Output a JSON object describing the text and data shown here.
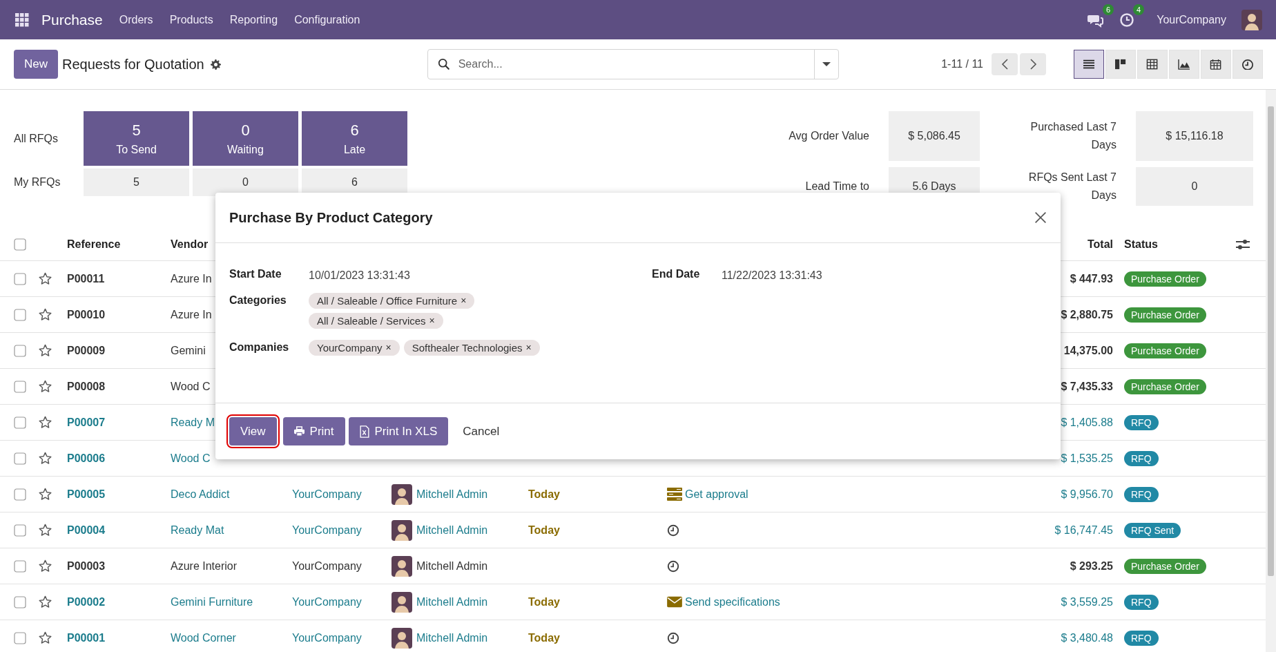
{
  "navbar": {
    "app": "Purchase",
    "menu": [
      "Orders",
      "Products",
      "Reporting",
      "Configuration"
    ],
    "messages_count": "6",
    "activities_count": "4",
    "company": "YourCompany"
  },
  "control_panel": {
    "new_button": "New",
    "title": "Requests for Quotation",
    "search": {
      "placeholder": "Search..."
    },
    "pager": "1-11 / 11",
    "views": [
      {
        "kind": "list",
        "selected": true
      },
      {
        "kind": "kanban",
        "selected": false
      },
      {
        "kind": "pivot",
        "selected": false
      },
      {
        "kind": "graph",
        "selected": false
      },
      {
        "kind": "calendar",
        "selected": false
      },
      {
        "kind": "activity",
        "selected": false
      }
    ]
  },
  "dashboard": {
    "rows": [
      {
        "label": "All RFQs",
        "kind": "tile",
        "cells": [
          {
            "value": "5",
            "caption": "To Send"
          },
          {
            "value": "0",
            "caption": "Waiting"
          },
          {
            "value": "6",
            "caption": "Late"
          }
        ]
      },
      {
        "label": "My RFQs",
        "kind": "plain",
        "cells": [
          {
            "value": "5"
          },
          {
            "value": "0"
          },
          {
            "value": "6"
          }
        ]
      }
    ],
    "stats": [
      {
        "label": "Avg Order Value",
        "value": "$ 5,086.45"
      },
      {
        "label": "Purchased Last 7 Days",
        "value": "$ 15,116.18"
      },
      {
        "label": "Lead Time to",
        "value": "5.6 Days"
      },
      {
        "label": "RFQs Sent Last 7 Days",
        "value": "0"
      }
    ]
  },
  "table": {
    "header_checkbox": {
      "checked": false
    },
    "columns": {
      "reference": "Reference",
      "vendor": "Vendor",
      "total": "Total",
      "status": "Status"
    },
    "rows": [
      {
        "checked": false,
        "starred": false,
        "highlight": false,
        "reference": "P00011",
        "vendor": "Azure In",
        "total": "$ 447.93",
        "status": {
          "label": "Purchase Order",
          "kind": "purchase"
        }
      },
      {
        "checked": false,
        "starred": false,
        "highlight": false,
        "reference": "P00010",
        "vendor": "Azure In",
        "total": "$ 2,880.75",
        "status": {
          "label": "Purchase Order",
          "kind": "purchase"
        }
      },
      {
        "checked": false,
        "starred": false,
        "highlight": false,
        "reference": "P00009",
        "vendor": "Gemini",
        "total": "14,375.00",
        "status": {
          "label": "Purchase Order",
          "kind": "purchase"
        }
      },
      {
        "checked": false,
        "starred": false,
        "highlight": false,
        "reference": "P00008",
        "vendor": "Wood C",
        "total": "$ 7,435.33",
        "status": {
          "label": "Purchase Order",
          "kind": "purchase"
        }
      },
      {
        "checked": false,
        "starred": false,
        "highlight": true,
        "reference": "P00007",
        "vendor": "Ready M",
        "total": "$ 1,405.88",
        "status": {
          "label": "RFQ",
          "kind": "rfq"
        }
      },
      {
        "checked": false,
        "starred": false,
        "highlight": true,
        "reference": "P00006",
        "vendor": "Wood C",
        "total": "$ 1,535.25",
        "status": {
          "label": "RFQ",
          "kind": "rfq"
        }
      },
      {
        "checked": false,
        "starred": false,
        "highlight": true,
        "reference": "P00005",
        "vendor": "Deco Addict",
        "company": "YourCompany",
        "buyer": "Mitchell Admin",
        "deadline": "Today",
        "activity": {
          "kind": "approval",
          "text": "Get approval"
        },
        "total": "$ 9,956.70",
        "status": {
          "label": "RFQ",
          "kind": "rfq"
        }
      },
      {
        "checked": false,
        "starred": false,
        "highlight": true,
        "reference": "P00004",
        "vendor": "Ready Mat",
        "company": "YourCompany",
        "buyer": "Mitchell Admin",
        "deadline": "Today",
        "activity": {
          "kind": "clock"
        },
        "total": "$ 16,747.45",
        "status": {
          "label": "RFQ Sent",
          "kind": "rfq"
        }
      },
      {
        "checked": false,
        "starred": false,
        "highlight": false,
        "reference": "P00003",
        "vendor": "Azure Interior",
        "company": "YourCompany",
        "buyer": "Mitchell Admin",
        "activity": {
          "kind": "clock"
        },
        "total": "$ 293.25",
        "status": {
          "label": "Purchase Order",
          "kind": "purchase"
        }
      },
      {
        "checked": false,
        "starred": false,
        "highlight": true,
        "reference": "P00002",
        "vendor": "Gemini Furniture",
        "company": "YourCompany",
        "buyer": "Mitchell Admin",
        "deadline": "Today",
        "activity": {
          "kind": "email",
          "text": "Send specifications"
        },
        "total": "$ 3,559.25",
        "status": {
          "label": "RFQ",
          "kind": "rfq"
        }
      },
      {
        "checked": false,
        "starred": false,
        "highlight": true,
        "reference": "P00001",
        "vendor": "Wood Corner",
        "company": "YourCompany",
        "buyer": "Mitchell Admin",
        "deadline": "Today",
        "activity": {
          "kind": "clock"
        },
        "total": "$ 3,480.48",
        "status": {
          "label": "RFQ",
          "kind": "rfq"
        }
      }
    ]
  },
  "dialog": {
    "title": "Purchase By Product Category",
    "fields": [
      {
        "label": "Start Date",
        "kind": "text",
        "value": "10/01/2023 13:31:43"
      },
      {
        "label": "End Date",
        "kind": "text",
        "value": "11/22/2023 13:31:43"
      },
      {
        "label": "Categories",
        "kind": "tags",
        "tags": [
          {
            "label": "All / Saleable / Office Furniture",
            "remove": "×"
          },
          {
            "label": "All / Saleable / Services",
            "remove": "×"
          }
        ]
      },
      {
        "label": "Companies",
        "kind": "tags",
        "tags": [
          {
            "label": "YourCompany",
            "remove": "×"
          },
          {
            "label": "Softhealer Technologies",
            "remove": "×"
          }
        ]
      }
    ],
    "buttons": [
      {
        "label": "View",
        "kind": "view",
        "outlined": true
      },
      {
        "label": "Print",
        "kind": "print",
        "outlined": false
      },
      {
        "label": "Print In XLS",
        "kind": "xls",
        "outlined": false
      },
      {
        "label": "Cancel",
        "kind": "cancel",
        "outlined": false
      }
    ]
  }
}
